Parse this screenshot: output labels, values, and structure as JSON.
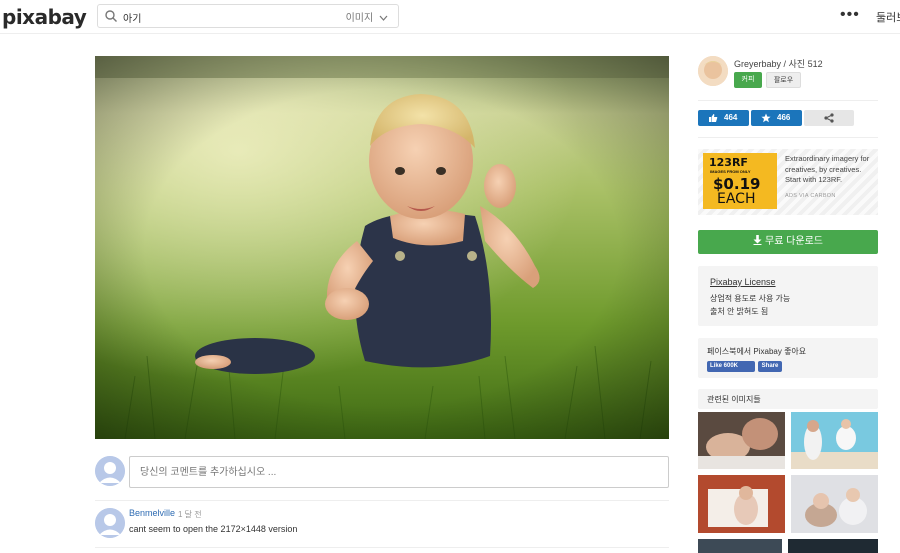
{
  "header": {
    "logo": "pixabay",
    "search_query": "아기",
    "search_type": "이미지",
    "more": "•••",
    "join_label": "둘러보"
  },
  "comments": {
    "input_placeholder": "당신의 코멘트를 추가하십시오 ...",
    "items": [
      {
        "author": "Benmelville",
        "time": "1 달 전",
        "text": "cant seem to open the 2172×1448 version"
      }
    ]
  },
  "sidebar": {
    "user": "Greyerbaby / 사진 512",
    "follow_label": "커피",
    "follow2_label": "팔로우",
    "likes": "464",
    "favorites": "466",
    "ad": {
      "brand": "123RF",
      "sub": "IMAGES FROM ONLY",
      "price": "$0.19",
      "each": "EACH",
      "text": "Extraordinary imagery for creatives, by creatives. Start with 123RF.",
      "via": "ADS VIA CARBON"
    },
    "download_label": "무료 다운로드",
    "license_title": "Pixabay License",
    "license_line1": "상업적 용도로 사용 가능",
    "license_line2": "출처 안 밝혀도 됨",
    "fb_text": "페이스북에서 Pixabay 좋아요",
    "fb_like": "Like 600K",
    "fb_share": "Share",
    "related_title": "관련된 이미지들"
  },
  "colors": {
    "accent_green": "#48a84d",
    "accent_blue": "#1b75bb",
    "fb_blue": "#4267b2"
  },
  "icons": [
    "search-icon",
    "chevron-down-icon",
    "thumbs-up-icon",
    "star-icon",
    "share-icon",
    "download-icon",
    "user-avatar-icon"
  ]
}
